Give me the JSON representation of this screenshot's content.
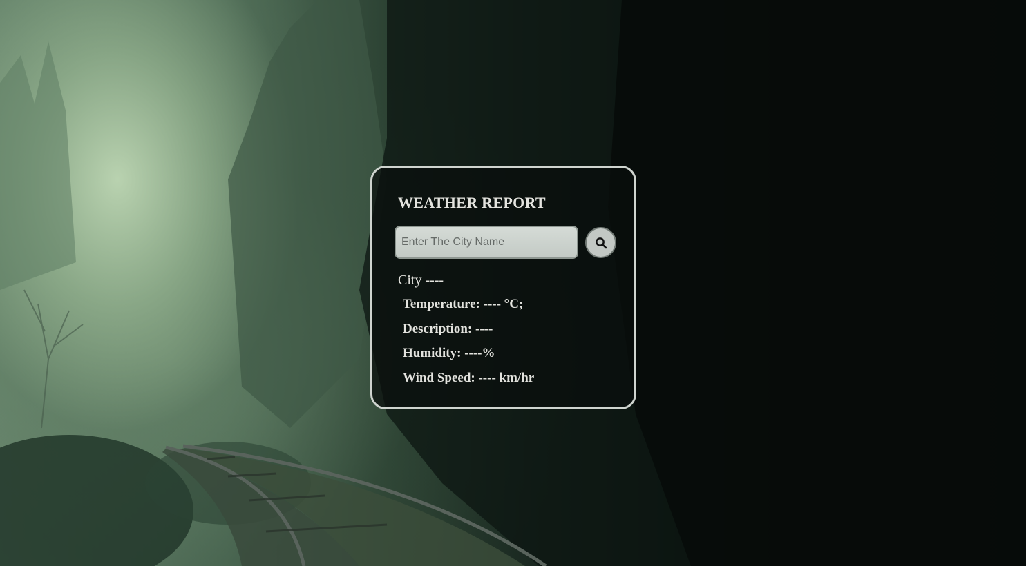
{
  "background": {
    "description_icon": "foggy-forest-railway-image"
  },
  "weather_card": {
    "title": "WEATHER REPORT",
    "search": {
      "placeholder": "Enter The City Name",
      "value": "",
      "button_icon": "search-icon"
    },
    "city_line": "City ----",
    "rows": [
      "Temperature: ---- °C;",
      "Description: ----",
      "Humidity: ----%",
      "Wind Speed: ---- km/hr"
    ],
    "border_color": "#cfd4cf"
  }
}
